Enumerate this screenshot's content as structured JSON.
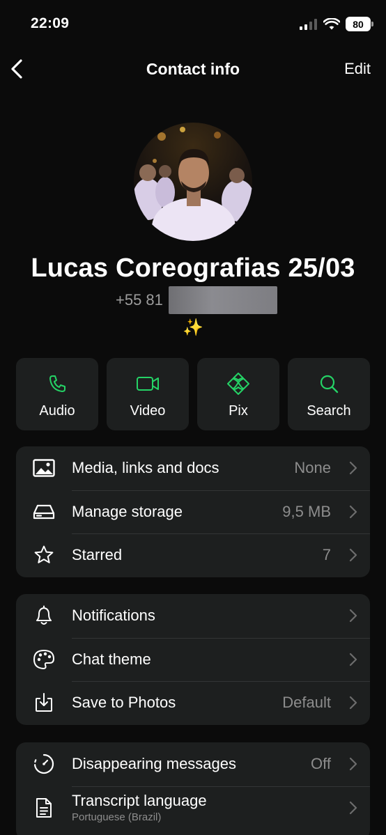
{
  "status_bar": {
    "time": "22:09",
    "battery": "80"
  },
  "nav": {
    "title": "Contact info",
    "edit_label": "Edit"
  },
  "profile": {
    "name": "Lucas Coreografias 25/03",
    "phone_visible": "+55 81",
    "sparkle": "✨"
  },
  "actions": [
    {
      "label": "Audio",
      "icon": "phone-icon"
    },
    {
      "label": "Video",
      "icon": "video-camera-icon"
    },
    {
      "label": "Pix",
      "icon": "pix-icon"
    },
    {
      "label": "Search",
      "icon": "search-icon"
    }
  ],
  "section_media": [
    {
      "label": "Media, links and docs",
      "value": "None",
      "icon": "image-icon"
    },
    {
      "label": "Manage storage",
      "value": "9,5 MB",
      "icon": "storage-icon"
    },
    {
      "label": "Starred",
      "value": "7",
      "icon": "star-icon"
    }
  ],
  "section_settings": [
    {
      "label": "Notifications",
      "value": "",
      "icon": "bell-icon"
    },
    {
      "label": "Chat theme",
      "value": "",
      "icon": "palette-icon"
    },
    {
      "label": "Save to Photos",
      "value": "Default",
      "icon": "save-download-icon"
    }
  ],
  "section_privacy": [
    {
      "label": "Disappearing messages",
      "value": "Off",
      "icon": "timer-icon"
    },
    {
      "label": "Transcript language",
      "sublabel": "Portuguese (Brazil)",
      "value": "",
      "icon": "document-icon"
    }
  ],
  "colors": {
    "accent": "#25d366",
    "background": "#0b0b0b",
    "card": "#1d1f1f",
    "secondary_text": "#8d8d8d"
  }
}
